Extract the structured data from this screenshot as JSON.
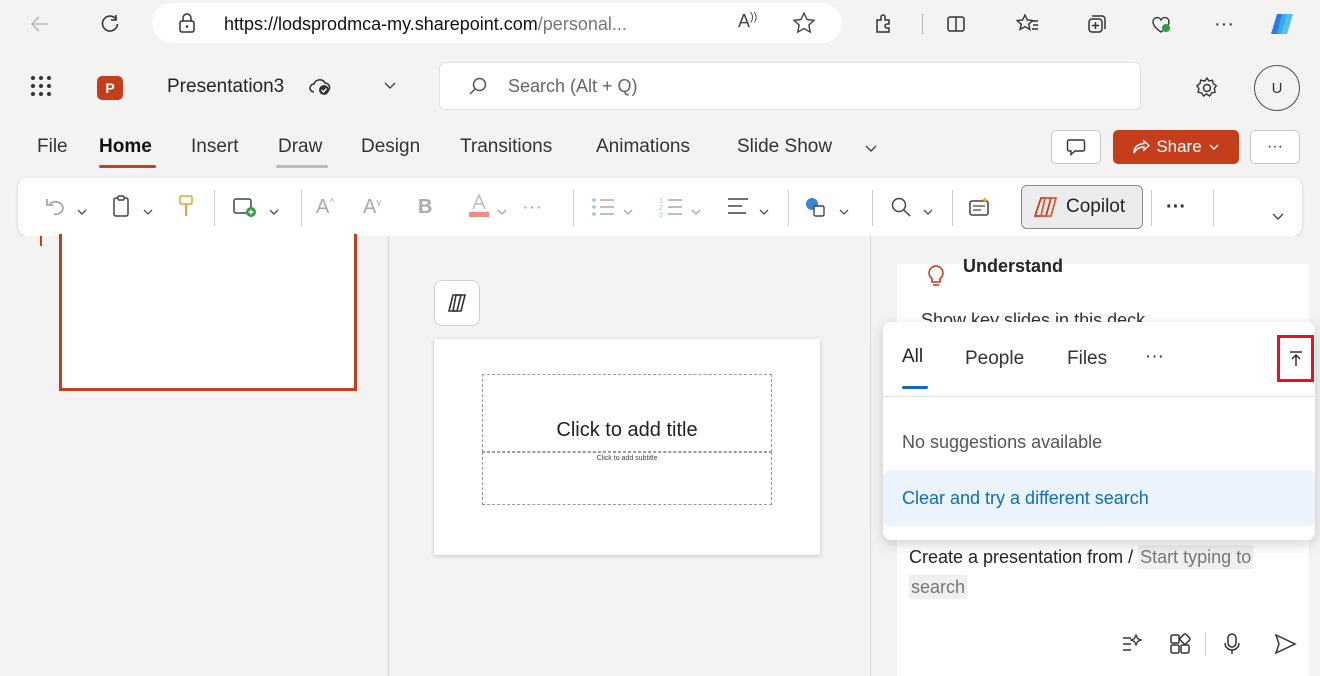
{
  "browser": {
    "url_domain": "https://lodsprodmca-my.sharepoint.com",
    "url_path": "/personal..."
  },
  "app": {
    "doc_name": "Presentation3",
    "search_placeholder": "Search (Alt + Q)",
    "avatar_initial": "U",
    "logo_letter": "P"
  },
  "ribbon": {
    "tabs": [
      "File",
      "Home",
      "Insert",
      "Draw",
      "Design",
      "Transitions",
      "Animations",
      "Slide Show"
    ],
    "active_tab": "Home",
    "share_label": "Share",
    "copilot_label": "Copilot"
  },
  "slide": {
    "title_placeholder": "Click to add title",
    "subtitle_placeholder": "Click to add subtitle"
  },
  "copilot": {
    "section_title": "Understand",
    "suggestion_text": "Show key slides in this deck",
    "prompt_prefix": "Create a presentation from /",
    "prompt_placeholder_1": "Start typing to",
    "prompt_placeholder_2": "search"
  },
  "dropdown": {
    "tabs": [
      "All",
      "People",
      "Files",
      "···"
    ],
    "active_tab": "All",
    "empty_message": "No suggestions available",
    "retry_label": "Clear and try a different search"
  },
  "colors": {
    "accent": "#0f6cbd",
    "brand": "#c43e1c",
    "highlight": "#e81123"
  }
}
